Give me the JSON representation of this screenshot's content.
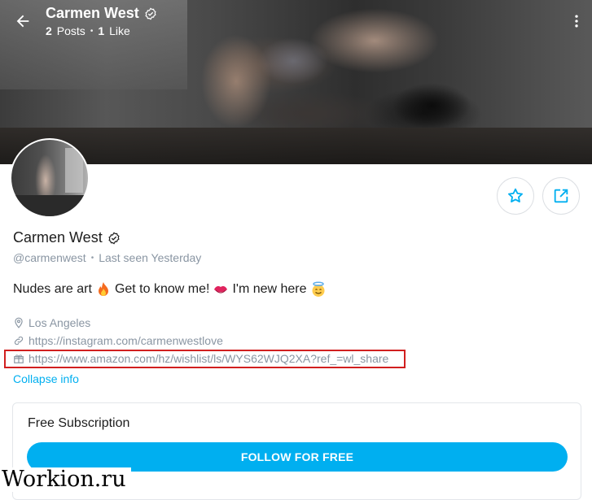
{
  "header": {
    "name": "Carmen West",
    "posts_count": "2",
    "posts_label": "Posts",
    "likes_count": "1",
    "likes_label": "Like",
    "icons": {
      "back": "arrow-left-icon",
      "more": "more-vertical-icon",
      "verified": "verified-badge-icon"
    }
  },
  "profile": {
    "name": "Carmen West",
    "handle": "@carmenwest",
    "last_seen": "Last seen Yesterday",
    "bio_parts": [
      "Nudes are art",
      "Get to know me!",
      "I'm new here"
    ],
    "bio_emojis": [
      "fire",
      "kiss-mark",
      "smiling-face-with-halo"
    ],
    "location": "Los Angeles",
    "instagram_url": "https://instagram.com/carmenwestlove",
    "wishlist_url": "https://www.amazon.com/hz/wishlist/ls/WYS62WJQ2XA?ref_=wl_share",
    "collapse_label": "Collapse info"
  },
  "actions": {
    "favorite_icon": "star-icon",
    "share_icon": "share-icon"
  },
  "subscription": {
    "title": "Free Subscription",
    "button_label": "FOLLOW FOR FREE"
  },
  "watermark": "Workion.ru",
  "colors": {
    "accent": "#00aff0",
    "muted": "#8a96a3",
    "highlight_box": "#d11f1f"
  }
}
